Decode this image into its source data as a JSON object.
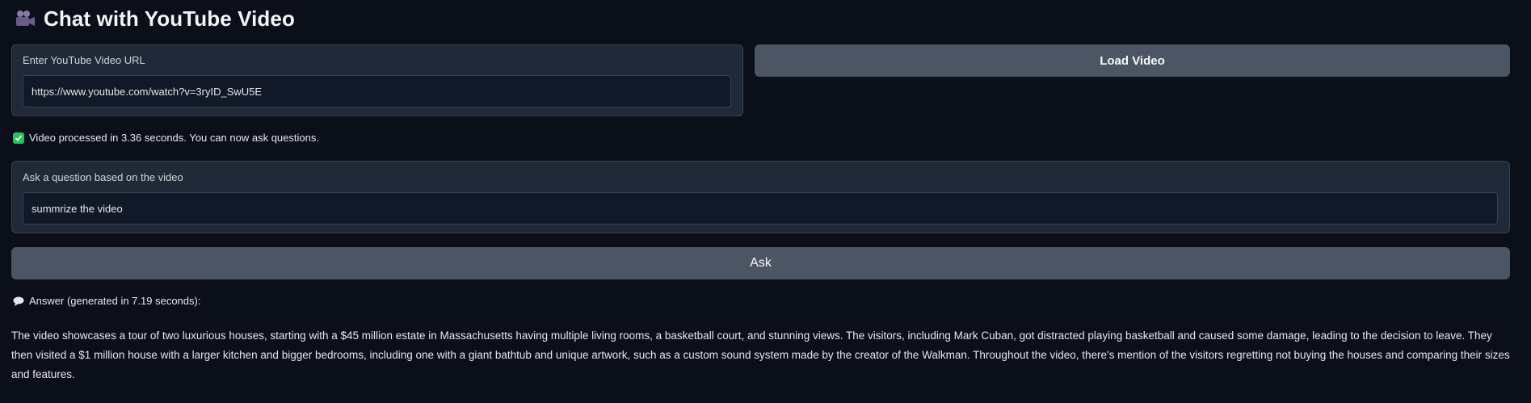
{
  "app": {
    "title": "Chat with YouTube Video",
    "title_icon": "movie-camera-icon"
  },
  "url_panel": {
    "label": "Enter YouTube Video URL",
    "value": "https://www.youtube.com/watch?v=3ryID_SwU5E",
    "placeholder": ""
  },
  "load_button": {
    "label": "Load Video"
  },
  "status": {
    "icon": "check-icon",
    "text": "Video processed in 3.36 seconds. You can now ask questions."
  },
  "question_panel": {
    "label": "Ask a question based on the video",
    "value": "summrize the video",
    "placeholder": ""
  },
  "ask_button": {
    "label": "Ask"
  },
  "answer": {
    "icon": "speech-bubble-icon",
    "header": "Answer (generated in 7.19 seconds):",
    "text": "The video showcases a tour of two luxurious houses, starting with a $45 million estate in Massachusetts having multiple living rooms, a basketball court, and stunning views. The visitors, including Mark Cuban, got distracted playing basketball and caused some damage, leading to the decision to leave. They then visited a $1 million house with a larger kitchen and bigger bedrooms, including one with a giant bathtub and unique artwork, such as a custom sound system made by the creator of the Walkman. Throughout the video, there's mention of the visitors regretting not buying the houses and comparing their sizes and features."
  },
  "colors": {
    "background": "#0b0f19",
    "panel": "#1f2937",
    "input": "#111827",
    "button": "#4b5563",
    "success": "#22c55e"
  }
}
